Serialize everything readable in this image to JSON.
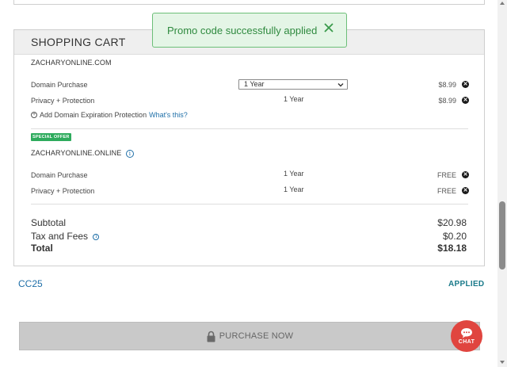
{
  "toast": {
    "message": "Promo code successfully applied",
    "close_icon": "close-icon"
  },
  "cart": {
    "title": "SHOPPING CART",
    "domains": [
      {
        "name": "ZACHARYONLINE.COM",
        "items": [
          {
            "label": "Domain Purchase",
            "term": "1 Year",
            "price": "$8.99"
          },
          {
            "label": "Privacy + Protection",
            "term": "1 Year",
            "price": "$8.99"
          }
        ],
        "add_protection": {
          "text": "Add Domain Expiration Protection",
          "link": "What's this?"
        }
      },
      {
        "badge": "SPECIAL OFFER",
        "name": "ZACHARYONLINE.ONLINE",
        "items": [
          {
            "label": "Domain Purchase",
            "term": "1 Year",
            "price": "FREE"
          },
          {
            "label": "Privacy + Protection",
            "term": "1 Year",
            "price": "FREE"
          }
        ]
      }
    ],
    "summary": {
      "subtotal_label": "Subtotal",
      "subtotal_value": "$20.98",
      "tax_label": "Tax and Fees",
      "tax_value": "$0.20",
      "total_label": "Total",
      "total_value": "$18.18"
    }
  },
  "promo": {
    "code": "CC25",
    "status": "APPLIED"
  },
  "purchase_button": {
    "label": "PURCHASE NOW"
  },
  "chat": {
    "label": "CHAT"
  },
  "colors": {
    "accent": "#1f6fa8",
    "success": "#2f8a3f",
    "chat": "#e0453f",
    "badge": "#2eab5d"
  }
}
